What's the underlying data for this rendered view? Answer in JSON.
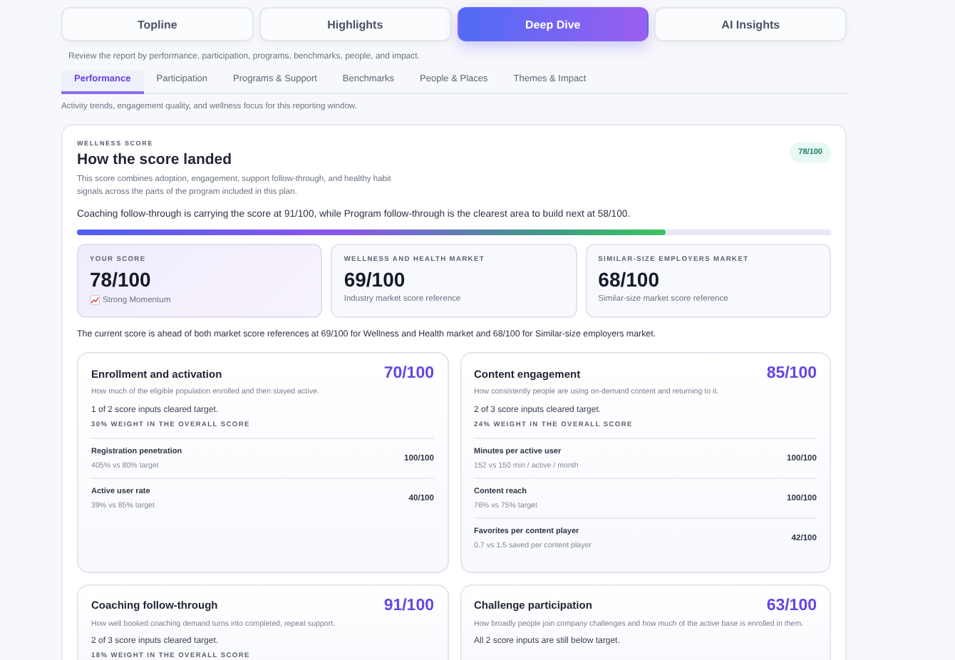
{
  "top_tabs": [
    {
      "label": "Topline",
      "selected": false
    },
    {
      "label": "Highlights",
      "selected": false
    },
    {
      "label": "Deep Dive",
      "selected": true
    },
    {
      "label": "AI Insights",
      "selected": false
    }
  ],
  "intro": "Review the report by performance, participation, programs, benchmarks, people, and impact.",
  "sub_tabs": [
    {
      "label": "Performance",
      "selected": true
    },
    {
      "label": "Participation",
      "selected": false
    },
    {
      "label": "Programs & Support",
      "selected": false
    },
    {
      "label": "Benchmarks",
      "selected": false
    },
    {
      "label": "People & Places",
      "selected": false
    },
    {
      "label": "Themes & Impact",
      "selected": false
    }
  ],
  "sub_intro": "Activity trends, engagement quality, and wellness focus for this reporting window.",
  "score_card": {
    "eyebrow": "WELLNESS SCORE",
    "title": "How the score landed",
    "badge": "78/100",
    "description": "This score combines adoption, engagement, support follow-through, and healthy habit signals across the parts of the program included in this plan.",
    "summary": "Coaching follow-through is carrying the score at 91/100, while Program follow-through is the clearest area to build next at 58/100.",
    "level": 0.78,
    "tiles": [
      {
        "kind": "own",
        "label": "YOUR SCORE",
        "value": "78/100",
        "note": "Strong Momentum"
      },
      {
        "kind": "market",
        "label": "WELLNESS AND HEALTH MARKET",
        "value": "69/100",
        "note": "Industry market score reference"
      },
      {
        "kind": "market",
        "label": "SIMILAR-SIZE EMPLOYERS MARKET",
        "value": "68/100",
        "note": "Similar-size market score reference"
      }
    ],
    "comparison": "The current score is ahead of both market score references at 69/100 for Wellness and Health market and 68/100 for Similar-size employers market."
  },
  "areas": [
    {
      "title": "Enrollment and activation",
      "score": "70/100",
      "description": "How much of the eligible population enrolled and then stayed active.",
      "status": "1 of 2 score inputs cleared target.",
      "weight": "30% WEIGHT IN THE OVERALL SCORE",
      "inputs": [
        {
          "name": "Registration penetration",
          "detail": "405% vs 80% target",
          "score": "100/100"
        },
        {
          "name": "Active user rate",
          "detail": "39% vs 85% target",
          "score": "40/100"
        }
      ]
    },
    {
      "title": "Content engagement",
      "score": "85/100",
      "description": "How consistently people are using on-demand content and returning to it.",
      "status": "2 of 3 score inputs cleared target.",
      "weight": "24% WEIGHT IN THE OVERALL SCORE",
      "inputs": [
        {
          "name": "Minutes per active user",
          "detail": "152 vs 150 min / active / month",
          "score": "100/100"
        },
        {
          "name": "Content reach",
          "detail": "76% vs 75% target",
          "score": "100/100"
        },
        {
          "name": "Favorites per content player",
          "detail": "0.7 vs 1.5 saved per content player",
          "score": "42/100"
        }
      ]
    },
    {
      "title": "Coaching follow-through",
      "score": "91/100",
      "description": "How well booked coaching demand turns into completed, repeat support.",
      "status": "2 of 3 score inputs cleared target.",
      "weight": "18% WEIGHT IN THE OVERALL SCORE"
    },
    {
      "title": "Challenge participation",
      "score": "63/100",
      "description": "How broadly people join company challenges and how much of the active base is enrolled in them.",
      "status": "All 2 score inputs are still below target."
    }
  ]
}
